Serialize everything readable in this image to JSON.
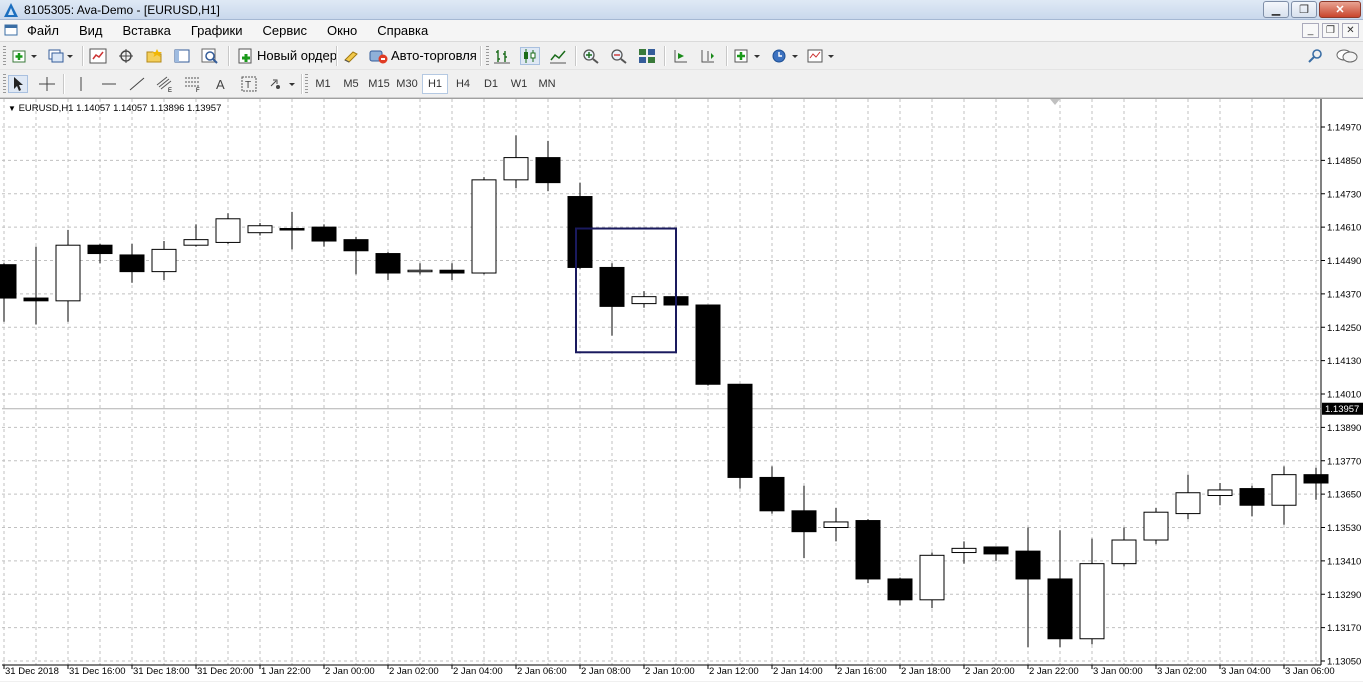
{
  "window": {
    "title": "8105305: Ava-Demo - [EURUSD,H1]"
  },
  "menu": [
    "Файл",
    "Вид",
    "Вставка",
    "Графики",
    "Сервис",
    "Окно",
    "Справка"
  ],
  "toolbar": {
    "new_order_label": "Новый ордер",
    "auto_trading_label": "Авто-торговля"
  },
  "timeframes": [
    "M1",
    "M5",
    "M15",
    "M30",
    "H1",
    "H4",
    "D1",
    "W1",
    "MN"
  ],
  "active_timeframe": "H1",
  "chart_header": "EURUSD,H1  1.14057 1.14057 1.13896 1.13957",
  "colors": {
    "grid": "#c0c0c0",
    "bull": "#ffffff",
    "bear": "#000000",
    "selection_rect": "#1a1a5e",
    "price_tag": "#000000"
  },
  "chart_data": {
    "type": "candlestick",
    "symbol": "EURUSD",
    "timeframe": "H1",
    "current_price": "1.13957",
    "ylim": [
      1.1305,
      1.1497
    ],
    "y_ticks": [
      "1.14970",
      "1.14850",
      "1.14730",
      "1.14610",
      "1.14490",
      "1.14370",
      "1.14250",
      "1.14130",
      "1.14010",
      "1.13890",
      "1.13770",
      "1.13650",
      "1.13530",
      "1.13410",
      "1.13290",
      "1.13170",
      "1.13050"
    ],
    "x_ticks": [
      "31 Dec 2018",
      "31 Dec 16:00",
      "31 Dec 18:00",
      "31 Dec 20:00",
      "1 Jan 22:00",
      "2 Jan 00:00",
      "2 Jan 02:00",
      "2 Jan 04:00",
      "2 Jan 06:00",
      "2 Jan 08:00",
      "2 Jan 10:00",
      "2 Jan 12:00",
      "2 Jan 14:00",
      "2 Jan 16:00",
      "2 Jan 18:00",
      "2 Jan 20:00",
      "2 Jan 22:00",
      "3 Jan 00:00",
      "3 Jan 02:00",
      "3 Jan 04:00",
      "3 Jan 06:00"
    ],
    "candles": [
      {
        "o": 1.14475,
        "h": 1.1448,
        "l": 1.1427,
        "c": 1.14355
      },
      {
        "o": 1.14355,
        "h": 1.1454,
        "l": 1.1426,
        "c": 1.14345
      },
      {
        "o": 1.14345,
        "h": 1.146,
        "l": 1.1427,
        "c": 1.14545
      },
      {
        "o": 1.14545,
        "h": 1.1455,
        "l": 1.1448,
        "c": 1.14515
      },
      {
        "o": 1.1451,
        "h": 1.1455,
        "l": 1.1441,
        "c": 1.1445
      },
      {
        "o": 1.1445,
        "h": 1.1456,
        "l": 1.1442,
        "c": 1.1453
      },
      {
        "o": 1.14545,
        "h": 1.1462,
        "l": 1.1454,
        "c": 1.14565
      },
      {
        "o": 1.14555,
        "h": 1.1466,
        "l": 1.1455,
        "c": 1.1464
      },
      {
        "o": 1.1459,
        "h": 1.14625,
        "l": 1.1458,
        "c": 1.14615
      },
      {
        "o": 1.14605,
        "h": 1.14665,
        "l": 1.1453,
        "c": 1.146
      },
      {
        "o": 1.1461,
        "h": 1.1462,
        "l": 1.1454,
        "c": 1.1456
      },
      {
        "o": 1.14565,
        "h": 1.14575,
        "l": 1.1444,
        "c": 1.14525
      },
      {
        "o": 1.14515,
        "h": 1.1452,
        "l": 1.1442,
        "c": 1.14445
      },
      {
        "o": 1.14455,
        "h": 1.1448,
        "l": 1.1444,
        "c": 1.14455
      },
      {
        "o": 1.14455,
        "h": 1.1448,
        "l": 1.1442,
        "c": 1.14445
      },
      {
        "o": 1.14445,
        "h": 1.1479,
        "l": 1.1444,
        "c": 1.1478
      },
      {
        "o": 1.1478,
        "h": 1.1494,
        "l": 1.1475,
        "c": 1.1486
      },
      {
        "o": 1.1486,
        "h": 1.1492,
        "l": 1.1474,
        "c": 1.1477
      },
      {
        "o": 1.1472,
        "h": 1.1477,
        "l": 1.1446,
        "c": 1.14465
      },
      {
        "o": 1.14465,
        "h": 1.1448,
        "l": 1.1422,
        "c": 1.14325
      },
      {
        "o": 1.14335,
        "h": 1.1438,
        "l": 1.1432,
        "c": 1.1436
      },
      {
        "o": 1.1436,
        "h": 1.1437,
        "l": 1.14325,
        "c": 1.1433
      },
      {
        "o": 1.1433,
        "h": 1.1433,
        "l": 1.1404,
        "c": 1.14045
      },
      {
        "o": 1.14045,
        "h": 1.14045,
        "l": 1.1367,
        "c": 1.1371
      },
      {
        "o": 1.1371,
        "h": 1.1375,
        "l": 1.1358,
        "c": 1.1359
      },
      {
        "o": 1.1359,
        "h": 1.1368,
        "l": 1.1342,
        "c": 1.13515
      },
      {
        "o": 1.1353,
        "h": 1.136,
        "l": 1.1348,
        "c": 1.1355
      },
      {
        "o": 1.13555,
        "h": 1.1356,
        "l": 1.1333,
        "c": 1.13345
      },
      {
        "o": 1.13345,
        "h": 1.1335,
        "l": 1.1325,
        "c": 1.1327
      },
      {
        "o": 1.1327,
        "h": 1.1344,
        "l": 1.1324,
        "c": 1.1343
      },
      {
        "o": 1.1344,
        "h": 1.1348,
        "l": 1.134,
        "c": 1.13455
      },
      {
        "o": 1.1346,
        "h": 1.1346,
        "l": 1.1341,
        "c": 1.13435
      },
      {
        "o": 1.13445,
        "h": 1.1353,
        "l": 1.131,
        "c": 1.13345
      },
      {
        "o": 1.13345,
        "h": 1.1352,
        "l": 1.131,
        "c": 1.1313
      },
      {
        "o": 1.1313,
        "h": 1.1349,
        "l": 1.1311,
        "c": 1.134
      },
      {
        "o": 1.134,
        "h": 1.1353,
        "l": 1.1339,
        "c": 1.13485
      },
      {
        "o": 1.13485,
        "h": 1.136,
        "l": 1.1347,
        "c": 1.13585
      },
      {
        "o": 1.1358,
        "h": 1.1372,
        "l": 1.1356,
        "c": 1.13655
      },
      {
        "o": 1.13645,
        "h": 1.1369,
        "l": 1.1361,
        "c": 1.13665
      },
      {
        "o": 1.1367,
        "h": 1.1368,
        "l": 1.1357,
        "c": 1.1361
      },
      {
        "o": 1.1361,
        "h": 1.1375,
        "l": 1.1354,
        "c": 1.1372
      },
      {
        "o": 1.1372,
        "h": 1.13745,
        "l": 1.1363,
        "c": 1.1369
      }
    ],
    "selection_box": {
      "from_bar": 18,
      "to_bar": 21,
      "price_top": 1.14605,
      "price_bottom": 1.1416
    }
  }
}
